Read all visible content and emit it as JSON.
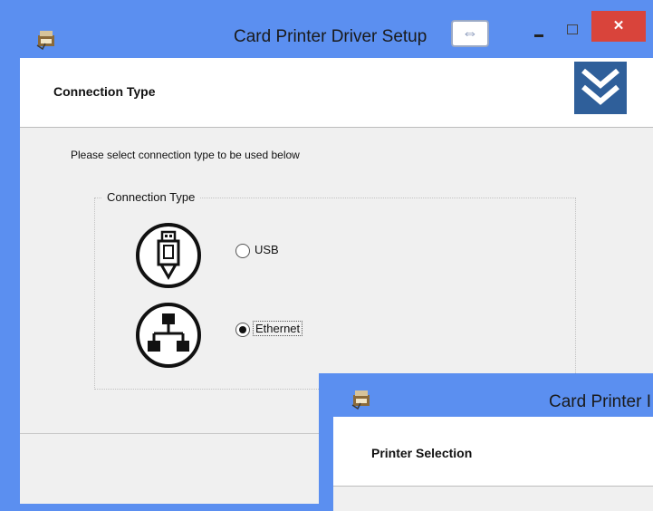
{
  "window_main": {
    "title": "Card Printer Driver Setup",
    "resize_glyph": "⇔",
    "close_glyph": "✕",
    "header_title": "Connection Type",
    "instruction": "Please select connection type to be used below",
    "group_label": "Connection Type",
    "options": [
      {
        "label": "USB",
        "selected": false,
        "icon": "usb-icon"
      },
      {
        "label": "Ethernet",
        "selected": true,
        "icon": "network-icon"
      }
    ]
  },
  "window_second": {
    "title": "Card Printer I",
    "header_title": "Printer Selection"
  },
  "colors": {
    "window_frame": "#5b8ff0",
    "close_button": "#d9443b",
    "dialog_bg": "#f0f0f0",
    "logo_bg": "#2f5f9a"
  }
}
